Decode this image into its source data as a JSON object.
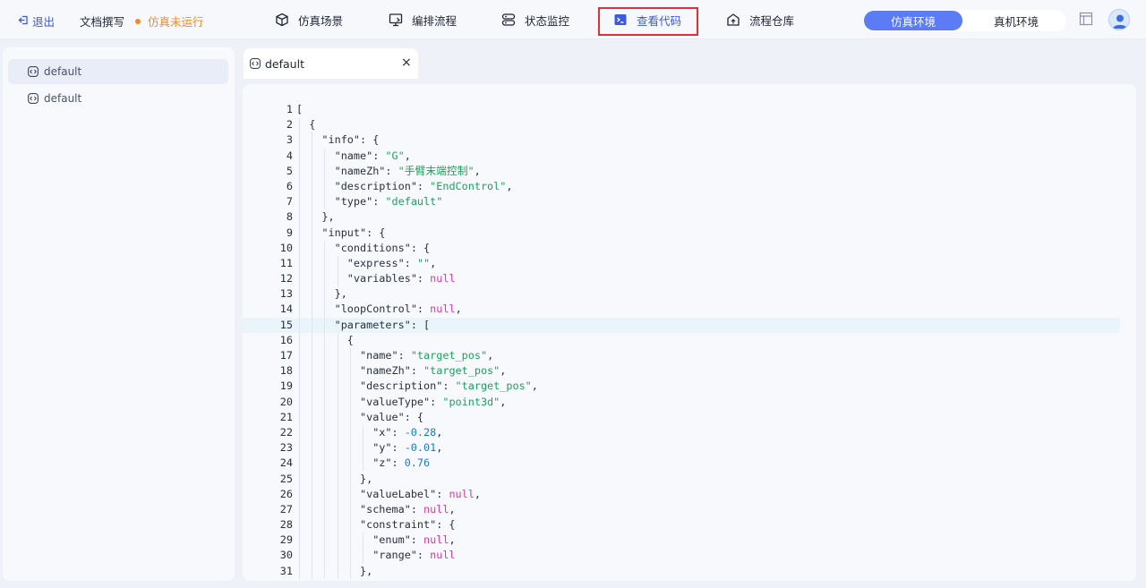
{
  "header": {
    "back_label": "退出",
    "doc_label": "文档撰写",
    "status_label": "仿真未运行",
    "nav": [
      {
        "label": "仿真场景",
        "icon": "cube-icon"
      },
      {
        "label": "编排流程",
        "icon": "monitor-icon"
      },
      {
        "label": "状态监控",
        "icon": "server-icon"
      },
      {
        "label": "查看代码",
        "icon": "terminal-icon",
        "active": true
      },
      {
        "label": "流程仓库",
        "icon": "warehouse-icon"
      }
    ],
    "env": {
      "sim_label": "仿真环境",
      "real_label": "真机环境",
      "selected": "仿真环境"
    },
    "colors": {
      "accent": "#3b5bdb",
      "status": "#f08c2e",
      "highlight_box": "#e03131",
      "env_active": "#5b7cf5"
    }
  },
  "sidebar": {
    "items": [
      {
        "label": "default",
        "selected": true
      },
      {
        "label": "default",
        "selected": false
      }
    ]
  },
  "editor": {
    "tab_label": "default",
    "current_line": 15,
    "lines": [
      {
        "n": 1,
        "indent": 0,
        "tokens": [
          [
            "p",
            "["
          ]
        ]
      },
      {
        "n": 2,
        "indent": 1,
        "tokens": [
          [
            "p",
            "{"
          ]
        ]
      },
      {
        "n": 3,
        "indent": 2,
        "tokens": [
          [
            "p",
            "\"info\": {"
          ]
        ]
      },
      {
        "n": 4,
        "indent": 3,
        "tokens": [
          [
            "p",
            "\"name\": "
          ],
          [
            "s",
            "\"G\""
          ],
          [
            "p",
            ","
          ]
        ]
      },
      {
        "n": 5,
        "indent": 3,
        "tokens": [
          [
            "p",
            "\"nameZh\": "
          ],
          [
            "s",
            "\"手臂末端控制\""
          ],
          [
            "p",
            ","
          ]
        ]
      },
      {
        "n": 6,
        "indent": 3,
        "tokens": [
          [
            "p",
            "\"description\": "
          ],
          [
            "s",
            "\"EndControl\""
          ],
          [
            "p",
            ","
          ]
        ]
      },
      {
        "n": 7,
        "indent": 3,
        "tokens": [
          [
            "p",
            "\"type\": "
          ],
          [
            "s",
            "\"default\""
          ]
        ]
      },
      {
        "n": 8,
        "indent": 2,
        "tokens": [
          [
            "p",
            "},"
          ]
        ]
      },
      {
        "n": 9,
        "indent": 2,
        "tokens": [
          [
            "p",
            "\"input\": {"
          ]
        ]
      },
      {
        "n": 10,
        "indent": 3,
        "tokens": [
          [
            "p",
            "\"conditions\": {"
          ]
        ]
      },
      {
        "n": 11,
        "indent": 4,
        "tokens": [
          [
            "p",
            "\"express\": "
          ],
          [
            "s",
            "\"\""
          ],
          [
            "p",
            ","
          ]
        ]
      },
      {
        "n": 12,
        "indent": 4,
        "tokens": [
          [
            "p",
            "\"variables\": "
          ],
          [
            "k",
            "null"
          ]
        ]
      },
      {
        "n": 13,
        "indent": 3,
        "tokens": [
          [
            "p",
            "},"
          ]
        ]
      },
      {
        "n": 14,
        "indent": 3,
        "tokens": [
          [
            "p",
            "\"loopControl\": "
          ],
          [
            "k",
            "null"
          ],
          [
            "p",
            ","
          ]
        ]
      },
      {
        "n": 15,
        "indent": 3,
        "tokens": [
          [
            "p",
            "\"parameters\": ["
          ]
        ]
      },
      {
        "n": 16,
        "indent": 4,
        "tokens": [
          [
            "p",
            "{"
          ]
        ]
      },
      {
        "n": 17,
        "indent": 5,
        "tokens": [
          [
            "p",
            "\"name\": "
          ],
          [
            "s",
            "\"target_pos\""
          ],
          [
            "p",
            ","
          ]
        ]
      },
      {
        "n": 18,
        "indent": 5,
        "tokens": [
          [
            "p",
            "\"nameZh\": "
          ],
          [
            "s",
            "\"target_pos\""
          ],
          [
            "p",
            ","
          ]
        ]
      },
      {
        "n": 19,
        "indent": 5,
        "tokens": [
          [
            "p",
            "\"description\": "
          ],
          [
            "s",
            "\"target_pos\""
          ],
          [
            "p",
            ","
          ]
        ]
      },
      {
        "n": 20,
        "indent": 5,
        "tokens": [
          [
            "p",
            "\"valueType\": "
          ],
          [
            "s",
            "\"point3d\""
          ],
          [
            "p",
            ","
          ]
        ]
      },
      {
        "n": 21,
        "indent": 5,
        "tokens": [
          [
            "p",
            "\"value\": {"
          ]
        ]
      },
      {
        "n": 22,
        "indent": 6,
        "tokens": [
          [
            "p",
            "\"x\": "
          ],
          [
            "n",
            "-0.28"
          ],
          [
            "p",
            ","
          ]
        ]
      },
      {
        "n": 23,
        "indent": 6,
        "tokens": [
          [
            "p",
            "\"y\": "
          ],
          [
            "n",
            "-0.01"
          ],
          [
            "p",
            ","
          ]
        ]
      },
      {
        "n": 24,
        "indent": 6,
        "tokens": [
          [
            "p",
            "\"z\": "
          ],
          [
            "n",
            "0.76"
          ]
        ]
      },
      {
        "n": 25,
        "indent": 5,
        "tokens": [
          [
            "p",
            "},"
          ]
        ]
      },
      {
        "n": 26,
        "indent": 5,
        "tokens": [
          [
            "p",
            "\"valueLabel\": "
          ],
          [
            "k",
            "null"
          ],
          [
            "p",
            ","
          ]
        ]
      },
      {
        "n": 27,
        "indent": 5,
        "tokens": [
          [
            "p",
            "\"schema\": "
          ],
          [
            "k",
            "null"
          ],
          [
            "p",
            ","
          ]
        ]
      },
      {
        "n": 28,
        "indent": 5,
        "tokens": [
          [
            "p",
            "\"constraint\": {"
          ]
        ]
      },
      {
        "n": 29,
        "indent": 6,
        "tokens": [
          [
            "p",
            "\"enum\": "
          ],
          [
            "k",
            "null"
          ],
          [
            "p",
            ","
          ]
        ]
      },
      {
        "n": 30,
        "indent": 6,
        "tokens": [
          [
            "p",
            "\"range\": "
          ],
          [
            "k",
            "null"
          ]
        ]
      },
      {
        "n": 31,
        "indent": 5,
        "tokens": [
          [
            "p",
            "},"
          ]
        ]
      }
    ]
  }
}
